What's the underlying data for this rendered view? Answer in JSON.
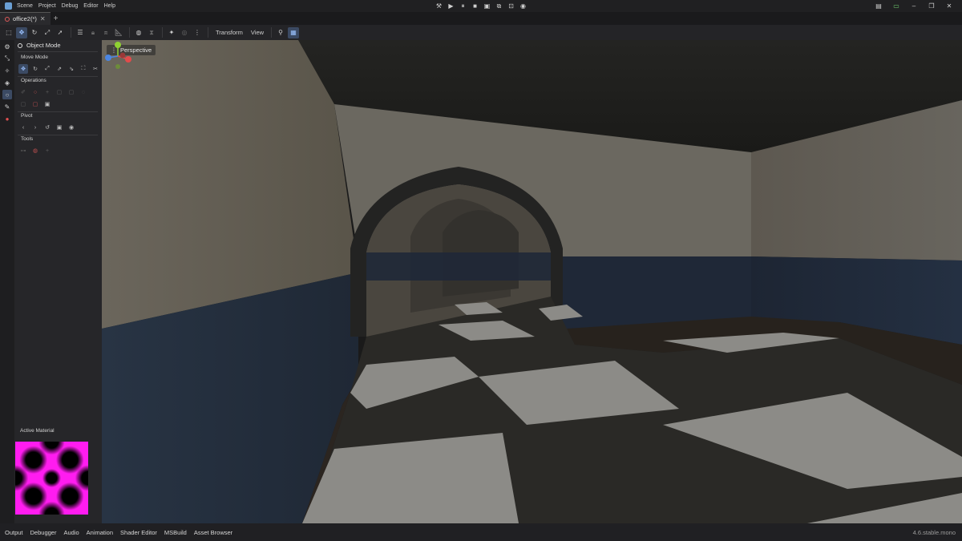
{
  "menubar": {
    "items": [
      "Scene",
      "Project",
      "Debug",
      "Editor",
      "Help"
    ]
  },
  "tabs": [
    {
      "label": "office2(*)"
    }
  ],
  "toolbar": {
    "transform_label": "Transform",
    "view_label": "View"
  },
  "panel": {
    "mode_label": "Object Mode",
    "sections": {
      "move_mode": "Move Mode",
      "operations": "Operations",
      "pivot": "Pivot",
      "tools": "Tools"
    },
    "active_material_label": "Active Material"
  },
  "viewport": {
    "perspective_label": "Perspective"
  },
  "bottom": {
    "tabs": [
      "Output",
      "Debugger",
      "Audio",
      "Animation",
      "Shader Editor",
      "MSBuild",
      "Asset Browser"
    ],
    "version": "4.6.stable.mono"
  },
  "colors": {
    "accent": "#3b4a63",
    "material_magenta": "#ff1cf0",
    "gizmo_x": "#e24b4b",
    "gizmo_y": "#8fd132",
    "gizmo_z": "#4b86e2"
  }
}
